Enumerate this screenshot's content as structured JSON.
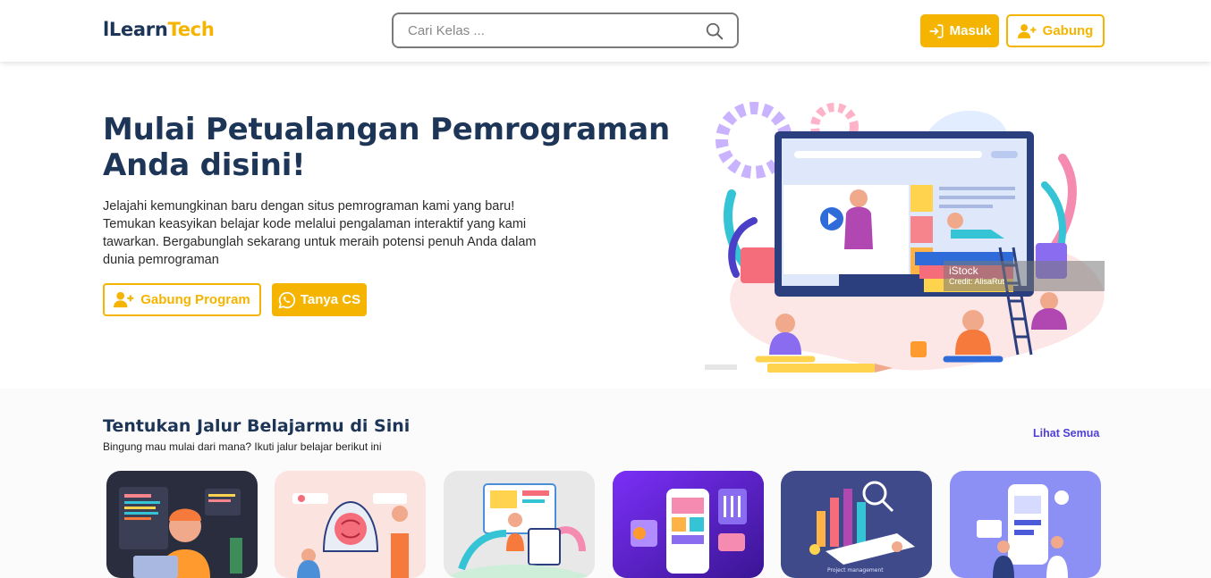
{
  "logo": {
    "part1": "lLearn",
    "part2": "Tech"
  },
  "search": {
    "placeholder": "Cari Kelas ..."
  },
  "nav": {
    "login_label": "Masuk",
    "join_label": "Gabung"
  },
  "hero": {
    "title": "Mulai Petualangan Pemrograman Anda disini!",
    "description": "Jelajahi kemungkinan baru dengan situs pemrograman kami yang baru! Temukan keasyikan belajar kode melalui pengalaman interaktif yang kami tawarkan. Bergabunglah sekarang untuk meraih potensi penuh Anda dalam dunia pemrograman",
    "join_program_label": "Gabung Program",
    "ask_cs_label": "Tanya CS",
    "image_credit_brand": "iStock",
    "image_credit_text": "Credit: AlisaRut"
  },
  "paths": {
    "title": "Tentukan Jalur Belajarmu di Sini",
    "subtitle": "Bingung mau mulai dari mana? Ikuti jalur belajar berikut ini",
    "see_all_label": "Lihat Semua",
    "card6_caption": "Project management"
  },
  "colors": {
    "accent": "#f5b400",
    "navy": "#1d3557",
    "link": "#4f3fd6"
  },
  "icons": [
    "search-icon",
    "login-icon",
    "add-user-icon",
    "whatsapp-icon"
  ]
}
